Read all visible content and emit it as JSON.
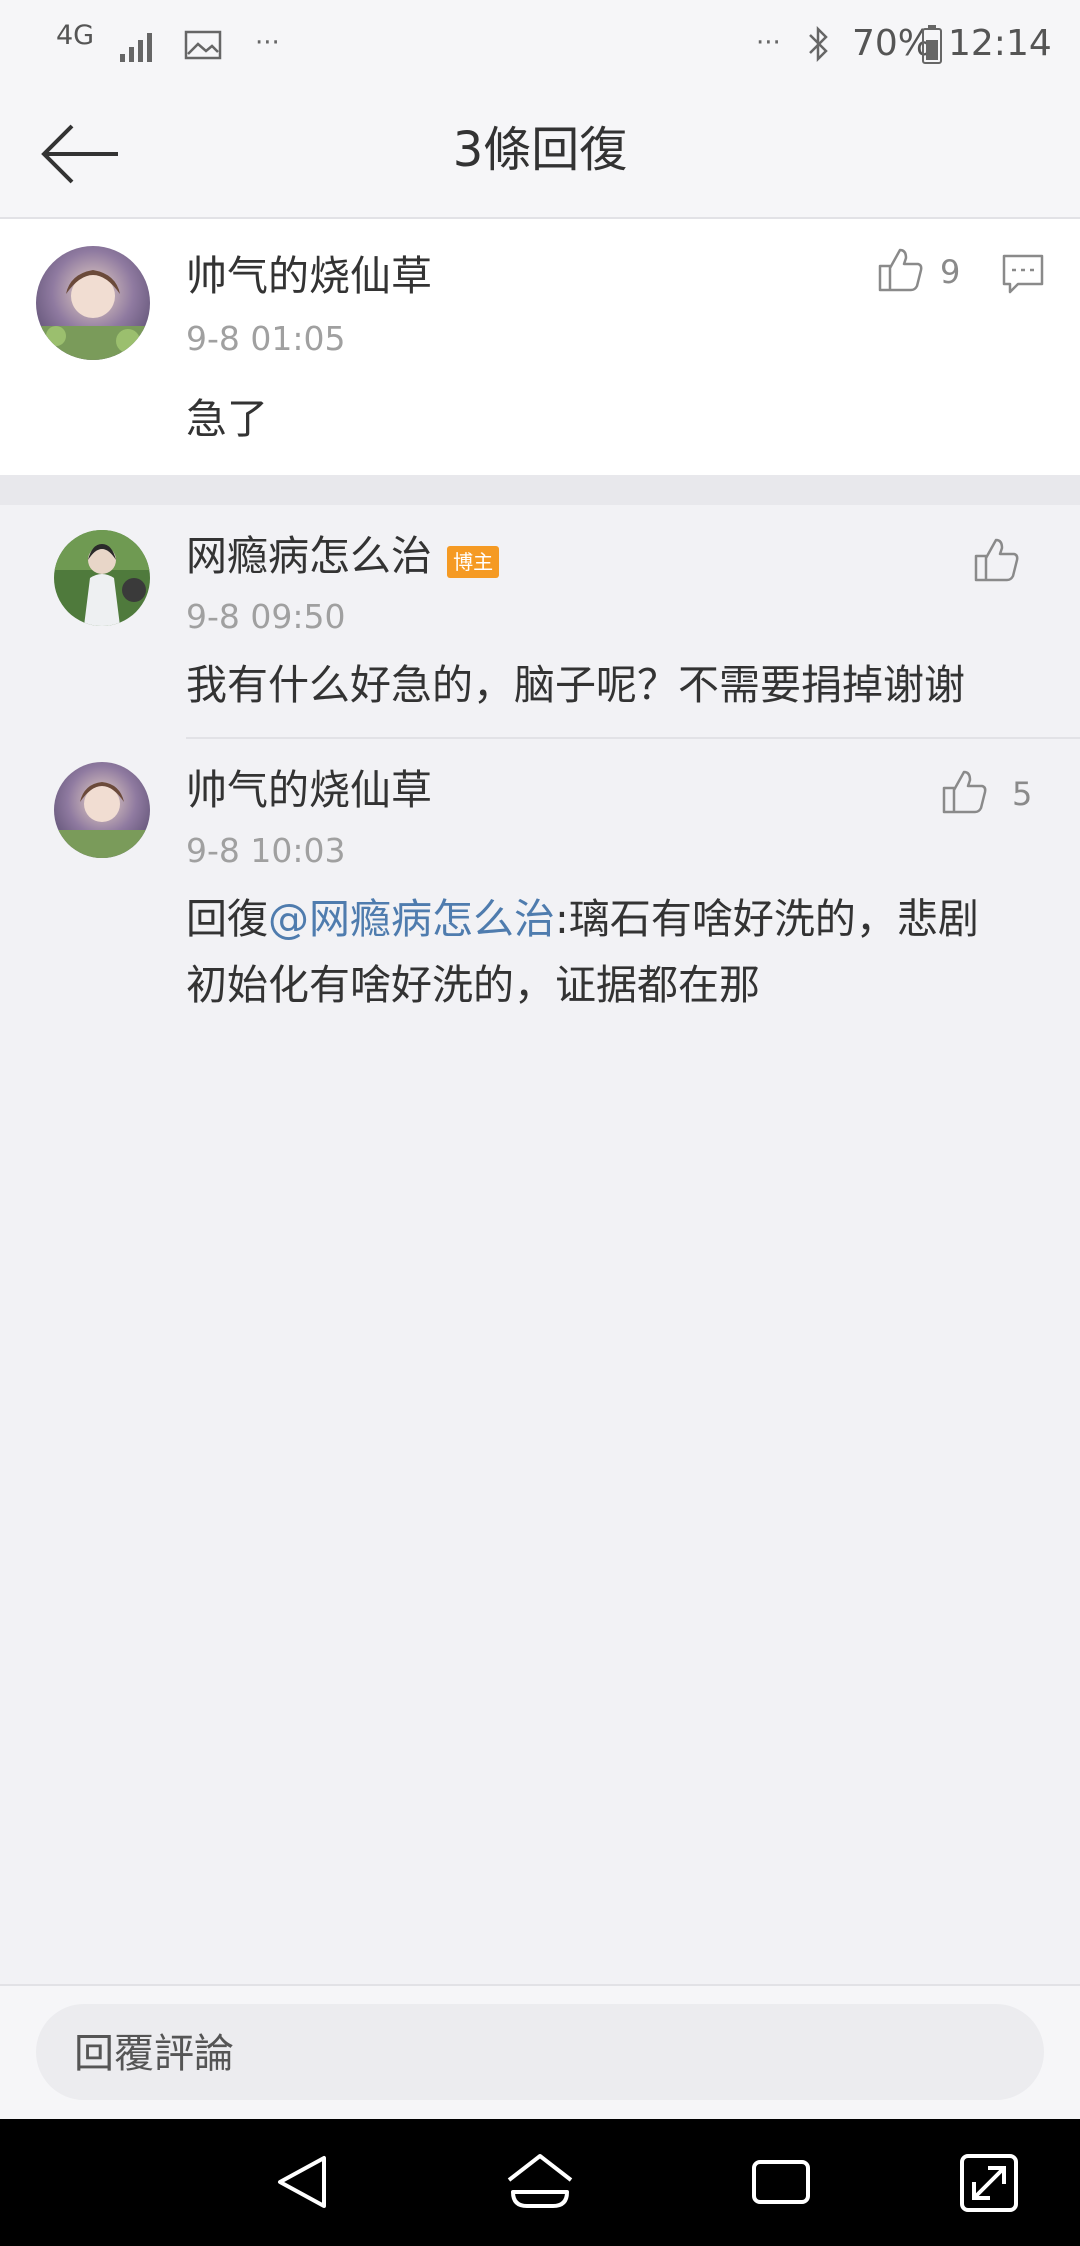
{
  "status_bar": {
    "network_label": "4G",
    "more_left": "···",
    "more_right": "···",
    "battery": "70%",
    "time": "12:14"
  },
  "header": {
    "title": "3條回復",
    "back_icon": "arrow-left-icon"
  },
  "main_comment": {
    "author": "帅气的烧仙草",
    "time": "9-8 01:05",
    "text": "急了",
    "likes": "9",
    "icons": [
      "thumbs-up-icon",
      "comment-icon"
    ]
  },
  "replies": [
    {
      "author": "网瘾病怎么治",
      "badge": "博主",
      "time": "9-8 09:50",
      "text": "我有什么好急的，脑子呢？不需要捐掉谢谢",
      "likes": ""
    },
    {
      "author": "帅气的烧仙草",
      "time": "9-8 10:03",
      "reply_prefix": "回復",
      "mention": "@网瘾病怎么治",
      "text_line1": ":璃石有啥好洗的，悲剧",
      "text_line2": "初始化有啥好洗的，证据都在那",
      "likes": "5"
    }
  ],
  "input": {
    "placeholder": "回覆評論"
  },
  "nav_bar": {
    "icons": [
      "back-triangle-icon",
      "home-icon",
      "recents-icon",
      "expand-icon"
    ]
  },
  "colors": {
    "link": "#4f7cae",
    "badge": "#f59a23",
    "background": "#f2f2f5"
  }
}
